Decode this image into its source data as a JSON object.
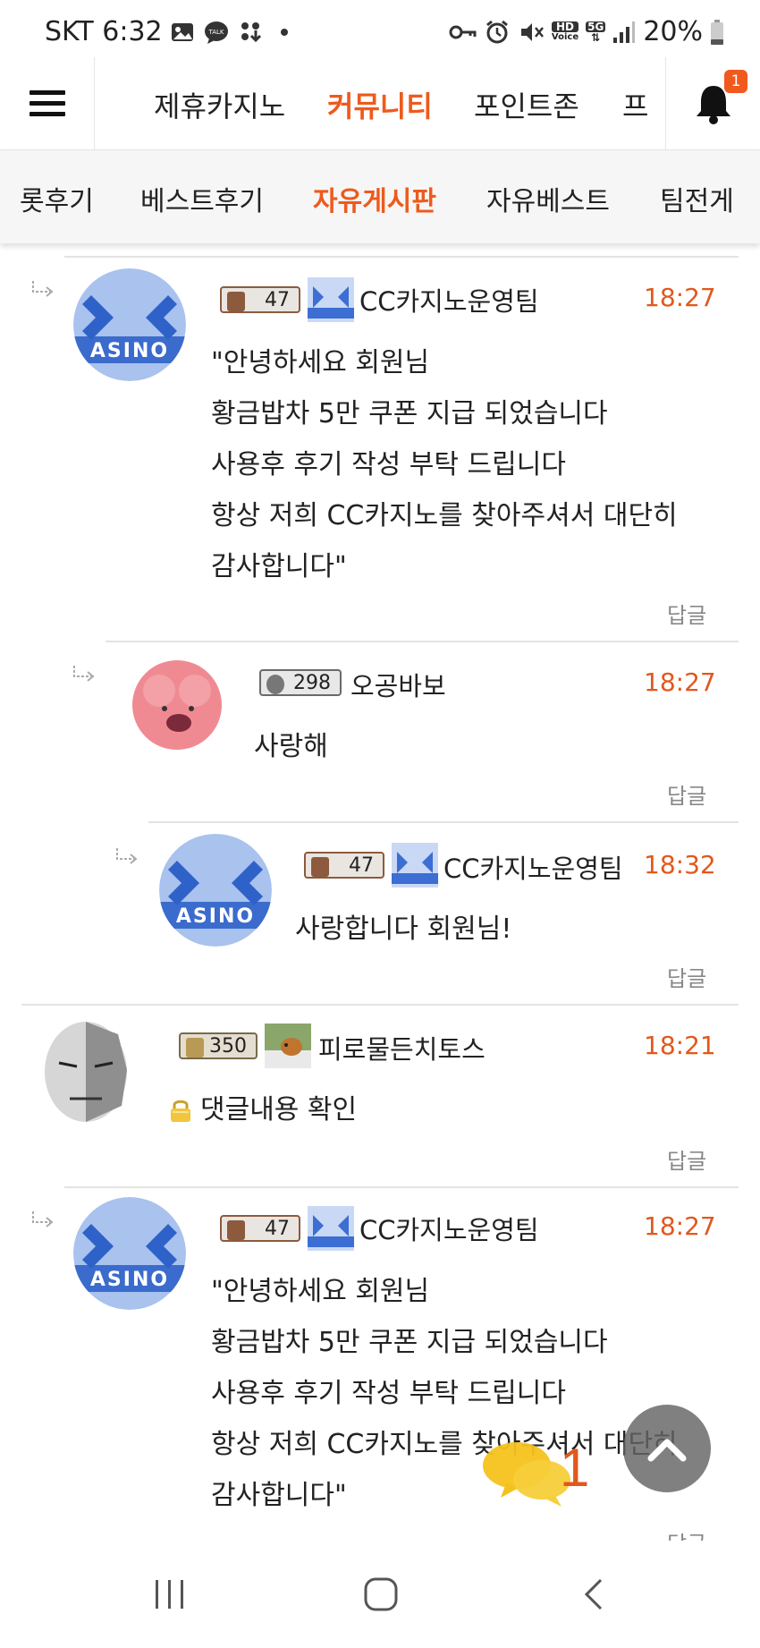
{
  "status_bar": {
    "carrier_time": "SKT 6:32",
    "left_icons": [
      "image-icon",
      "talk-icon",
      "download-icon",
      "dot-icon"
    ],
    "talk_label": "TALK",
    "hd_label": "HD",
    "voice_label": "Voice",
    "net_label": "5G",
    "battery": "20%",
    "right_icons": [
      "key-icon",
      "alarm-icon",
      "mute-icon",
      "hd-voice-icon",
      "5g-icon",
      "signal-icon",
      "battery-icon"
    ]
  },
  "top_nav": {
    "tabs": [
      {
        "label": "제휴카지노",
        "active": false
      },
      {
        "label": "커뮤니티",
        "active": true
      },
      {
        "label": "포인트존",
        "active": false
      },
      {
        "label": "프",
        "active": false
      }
    ],
    "notification_count": "1",
    "accent": "#ee5a1c"
  },
  "sub_nav": {
    "tabs": [
      {
        "label": "롯후기",
        "active": false
      },
      {
        "label": "베스트후기",
        "active": false
      },
      {
        "label": "자유게시판",
        "active": true
      },
      {
        "label": "자유베스트",
        "active": false
      },
      {
        "label": "팀전게",
        "active": false
      }
    ]
  },
  "comments": [
    {
      "level": "47",
      "nickname": "CC카지노운영팀",
      "time": "18:27",
      "lines": [
        "\"안녕하세요 회원님",
        "황금밥차 5만 쿠폰 지급 되었습니다",
        "사용후 후기 작성 부탁 드립니다",
        "항상 저희 CC카지노를 찾아주셔서 대단히",
        "감사합니다\""
      ],
      "reply_label": "답글"
    },
    {
      "level": "298",
      "nickname": "오공바보",
      "time": "18:27",
      "lines": [
        "사랑해"
      ],
      "reply_label": "답글"
    },
    {
      "level": "47",
      "nickname": "CC카지노운영팀",
      "time": "18:32",
      "lines": [
        "사랑합니다 회원님!"
      ],
      "reply_label": "답글"
    },
    {
      "level": "350",
      "nickname": "피로물든치토스",
      "time": "18:21",
      "lines": [
        "댓글내용 확인"
      ],
      "reply_label": "답글"
    },
    {
      "level": "47",
      "nickname": "CC카지노운영팀",
      "time": "18:27",
      "lines": [
        "\"안녕하세요 회원님",
        "황금밥차 5만 쿠폰 지급 되었습니다",
        "사용후 후기 작성 부탁 드립니다",
        "항상 저희 CC카지노를 찾아주셔서 대단히",
        "감사합니다\""
      ],
      "reply_label": "답글"
    }
  ],
  "floating": {
    "chat_count": "1"
  }
}
